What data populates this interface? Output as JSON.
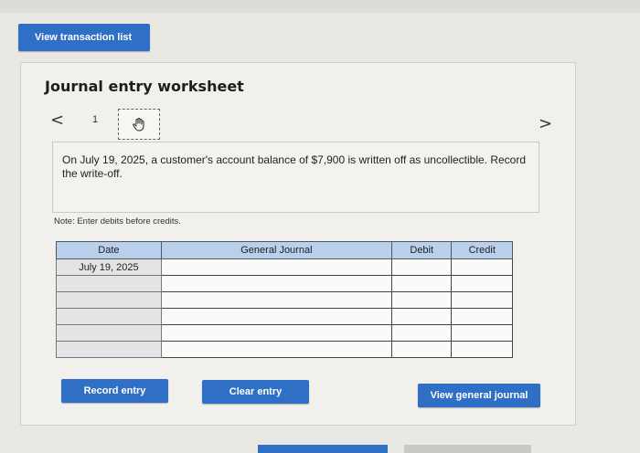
{
  "toolbar": {
    "view_transaction_list": "View transaction list"
  },
  "worksheet": {
    "title": "Journal entry worksheet",
    "nav": {
      "prev_icon": "<",
      "current_number": "1",
      "next_icon": ">"
    },
    "prompt": "On July 19, 2025, a customer's account balance of $7,900 is written off as uncollectible. Record the write-off.",
    "note": "Note: Enter debits before credits.",
    "table": {
      "headers": {
        "date": "Date",
        "account": "General Journal",
        "debit": "Debit",
        "credit": "Credit"
      },
      "rows": [
        {
          "date": "July 19, 2025",
          "account": "",
          "debit": "",
          "credit": ""
        },
        {
          "date": "",
          "account": "",
          "debit": "",
          "credit": ""
        },
        {
          "date": "",
          "account": "",
          "debit": "",
          "credit": ""
        },
        {
          "date": "",
          "account": "",
          "debit": "",
          "credit": ""
        },
        {
          "date": "",
          "account": "",
          "debit": "",
          "credit": ""
        },
        {
          "date": "",
          "account": "",
          "debit": "",
          "credit": ""
        }
      ]
    },
    "buttons": {
      "record": "Record entry",
      "clear": "Clear entry",
      "view_general": "View general journal"
    }
  },
  "colors": {
    "accent": "#2f6fc6",
    "header_fill": "#b9d0ec"
  },
  "icons": {
    "hand": "hand-pointer-icon",
    "prev": "chevron-left-icon",
    "next": "chevron-right-icon"
  }
}
